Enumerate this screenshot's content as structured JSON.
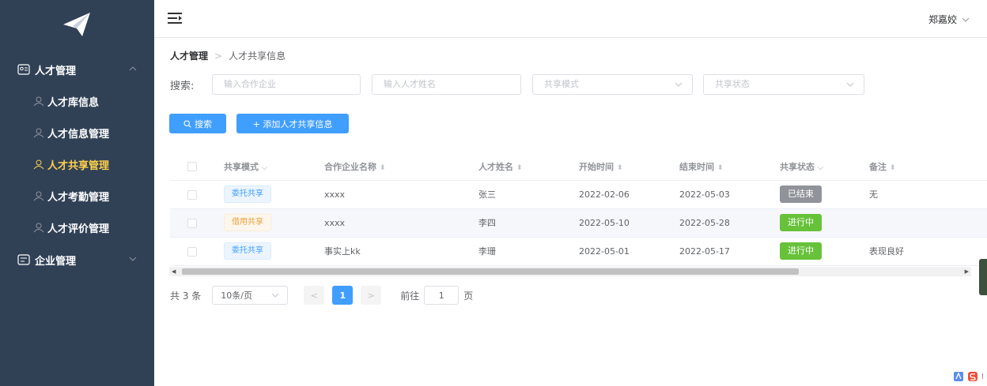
{
  "sidebar": {
    "logo_icon": "paper-plane-icon",
    "groups": [
      {
        "label": "人才管理",
        "icon": "id-card-icon",
        "expanded": true
      },
      {
        "label": "企业管理",
        "icon": "building-icon",
        "expanded": false
      }
    ],
    "items": [
      {
        "label": "人才库信息",
        "icon": "user-group-icon",
        "active": false
      },
      {
        "label": "人才信息管理",
        "icon": "user-group-icon",
        "active": false
      },
      {
        "label": "人才共享管理",
        "icon": "user-group-icon",
        "active": true
      },
      {
        "label": "人才考勤管理",
        "icon": "user-group-icon",
        "active": false
      },
      {
        "label": "人才评价管理",
        "icon": "user-group-icon",
        "active": false
      }
    ],
    "colors": {
      "bg": "#304156",
      "active": "#ffd04b"
    }
  },
  "header": {
    "user_name": "郑嘉姣"
  },
  "breadcrumb": {
    "parent": "人才管理",
    "current": "人才共享信息"
  },
  "search": {
    "label": "搜索:",
    "company_placeholder": "输入合作企业",
    "name_placeholder": "输入人才姓名",
    "mode_placeholder": "共享模式",
    "status_placeholder": "共享状态",
    "search_button": "搜索",
    "add_button": "+ 添加人才共享信息"
  },
  "table": {
    "headers": [
      "共享模式",
      "合作企业名称",
      "人才姓名",
      "开始时间",
      "结束时间",
      "共享状态",
      "备注"
    ],
    "rows": [
      {
        "mode": "委托共享",
        "company": "xxxx",
        "name": "张三",
        "start": "2022-02-06",
        "end": "2022-05-03",
        "status": "已结束",
        "note": "无"
      },
      {
        "mode": "借用共享",
        "company": "xxxx",
        "name": "李四",
        "start": "2022-05-10",
        "end": "2022-05-28",
        "status": "进行中",
        "note": ""
      },
      {
        "mode": "委托共享",
        "company": "事实上kk",
        "name": "李珊",
        "start": "2022-05-01",
        "end": "2022-05-17",
        "status": "进行中",
        "note": "表现良好"
      }
    ]
  },
  "pagination": {
    "total": "共 3 条",
    "page_size": "10条/页",
    "current_page": "1",
    "goto_label": "前往",
    "goto_value": "1",
    "page_suffix": "页"
  },
  "colors": {
    "primary": "#409eff",
    "success": "#67c23a",
    "info": "#909399",
    "warning": "#e6a23c"
  }
}
